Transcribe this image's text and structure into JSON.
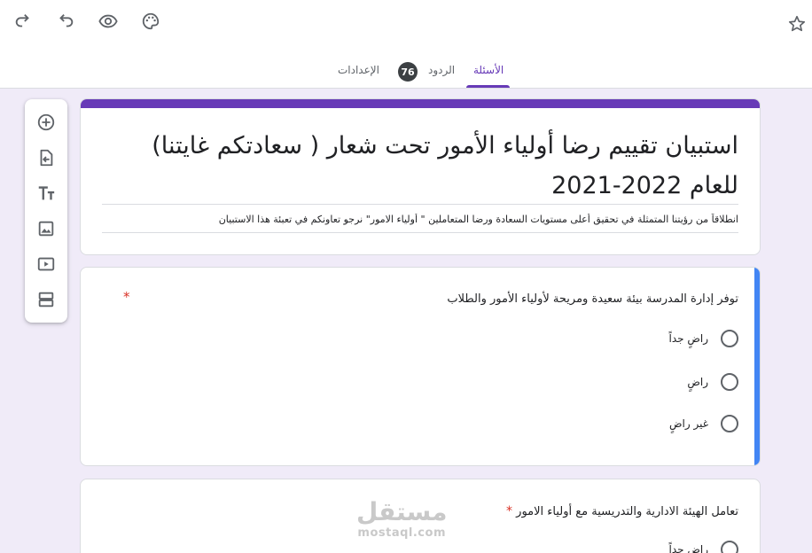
{
  "toolbar": {
    "icons": [
      "redo-icon",
      "undo-icon",
      "preview-eye-icon",
      "palette-icon",
      "star-icon"
    ]
  },
  "tabs": {
    "questions": "الأسئلة",
    "responses": "الردود",
    "responses_count": "76",
    "settings": "الإعدادات"
  },
  "side_tools": {
    "icons": [
      "add-question-icon",
      "import-questions-icon",
      "add-title-icon",
      "add-image-icon",
      "add-video-icon",
      "add-section-icon"
    ]
  },
  "form": {
    "title": "استبيان  تقييم رضا   أولياء الأمور تحت شعار ( سعادتكم  غايتنا) للعام 2022-2021",
    "description": "انطلاقاً من رؤيتنا المتمثلة في تحقيق أعلى مستويات  السعادة ورضا المتعاملين \" أولياء الامور\" نرجو تعاونكم في تعبئة هذا الاستبيان"
  },
  "questions": [
    {
      "text": "توفر إدارة المدرسة  بيئة سعيدة ومريحة لأولياء الأمور والطلاب",
      "required_mark": "*",
      "options": [
        "راضٍ جداً",
        "راضٍ",
        "غير راضٍ"
      ]
    },
    {
      "text": "تعامل الهيئة الادارية  والتدريسية مع أولياء الامور",
      "required_mark": "*",
      "options": [
        "راضٍ جداً"
      ]
    }
  ],
  "watermark": {
    "arabic": "مستقل",
    "latin": "mostaql.com"
  },
  "colors": {
    "theme_purple": "#673ab7",
    "active_blue": "#4285f4",
    "background": "#f0ebf8",
    "required_red": "#d93025"
  }
}
